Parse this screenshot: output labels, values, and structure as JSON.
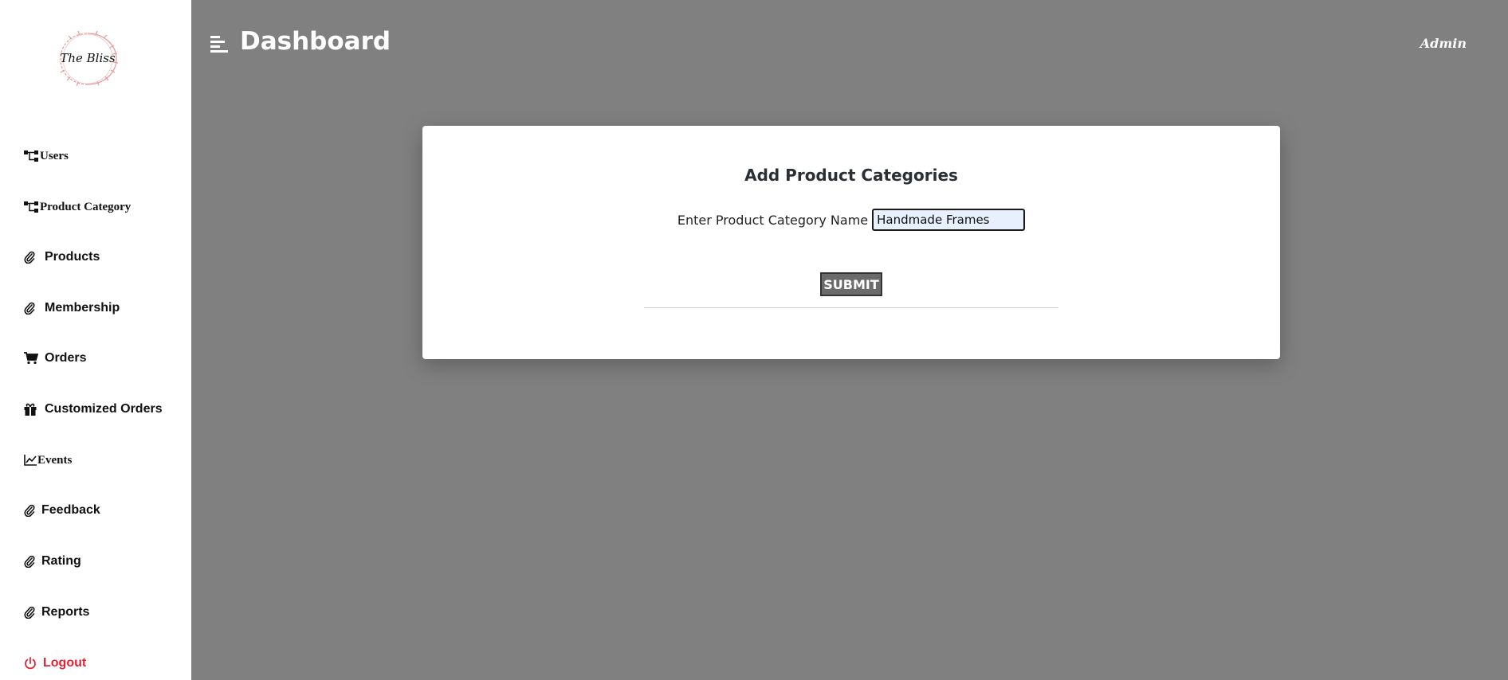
{
  "header": {
    "title": "Dashboard",
    "user": "Admin"
  },
  "sidebar": {
    "logo_text": "The Bliss",
    "items": [
      {
        "label": "Users",
        "icon": "sitemap-icon"
      },
      {
        "label": "Product Category",
        "icon": "sitemap-icon"
      },
      {
        "label": "Products",
        "icon": "paperclip-icon"
      },
      {
        "label": "Membership",
        "icon": "paperclip-icon"
      },
      {
        "label": "Orders",
        "icon": "cart-icon"
      },
      {
        "label": "Customized Orders",
        "icon": "gift-icon"
      },
      {
        "label": "Events",
        "icon": "chart-line-icon"
      },
      {
        "label": "Feedback",
        "icon": "paperclip-icon"
      },
      {
        "label": "Rating",
        "icon": "paperclip-icon"
      },
      {
        "label": "Reports",
        "icon": "paperclip-icon"
      },
      {
        "label": "Logout",
        "icon": "power-icon"
      }
    ]
  },
  "form": {
    "title": "Add Product Categories",
    "field_label": "Enter Product Category Name",
    "field_value": "Handmade Frames",
    "submit_label": "SUBMIT"
  },
  "colors": {
    "background": "#808080",
    "sidebar": "#ffffff",
    "logout": "#e02433",
    "submit": "#6b6b6b",
    "input_fill": "#e8f0fe"
  }
}
